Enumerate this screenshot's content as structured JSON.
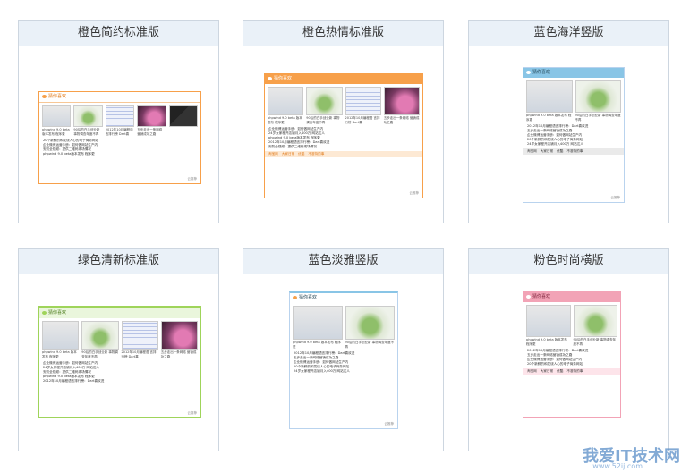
{
  "cards": [
    {
      "title": "橙色简约标准版"
    },
    {
      "title": "橙色热情标准版"
    },
    {
      "title": "蓝色海洋竖版"
    },
    {
      "title": "绿色清新标准版"
    },
    {
      "title": "蓝色淡雅竖版"
    },
    {
      "title": "粉色时尚横版"
    }
  ],
  "widget": {
    "header": "猜你喜欢",
    "thumb_captions": [
      "phpwind 9.0 beta 版本发布 程序更",
      "90后的白手创业新 事物调查年度不再",
      "2012年10月编程语 言排行榜 Dart喜",
      "五步走出一条网络 营销成功之路"
    ],
    "list_items": [
      "2012年10月编程语言排行榜：Dart喜欢进",
      "五步走出一条网络营销成功之路",
      "企业微博运营手册：如何做网站生产内",
      "20个新鲜的和发烧人心的电子商务网站",
      "24岁女家程开店铺月入400万 网站达人",
      "安防全视频：提供二维码现场情况",
      "phpwind 9.0 beta版本发布 程序更",
      "90后的白手创业新事物调查年度不再"
    ],
    "tags": [
      "淘宝网",
      "大家日常",
      "优酷",
      "不准特的事"
    ],
    "footer": "云推荐"
  },
  "watermark": {
    "text": "我爱IT技术网",
    "url": "www.52ij.com"
  },
  "colors": {
    "orange": "#f7a04a",
    "blue": "#89c5e6",
    "green": "#9fd45a",
    "pink": "#f2a3b6",
    "lightblue": "#b9d3ee"
  }
}
